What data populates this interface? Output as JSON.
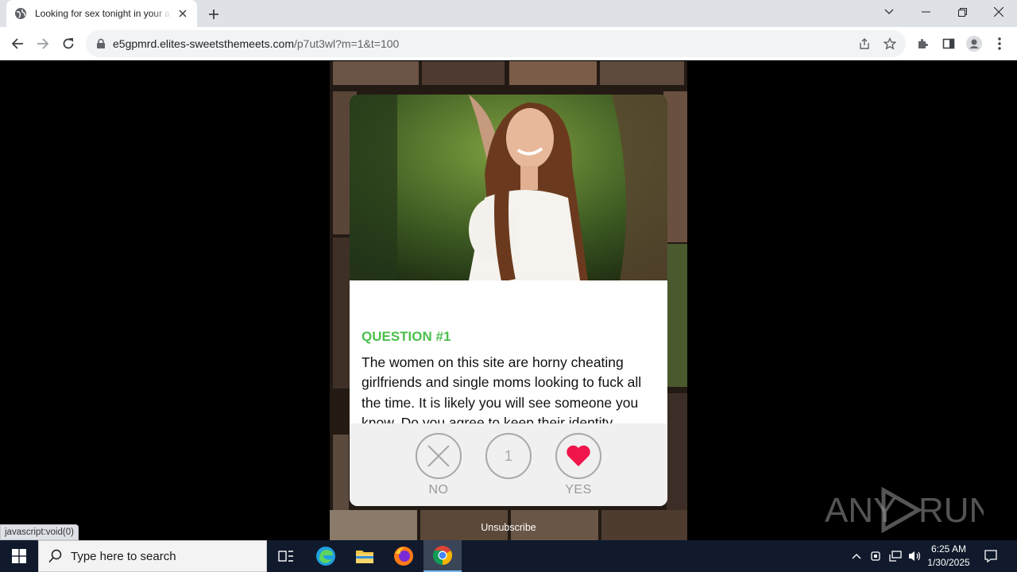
{
  "browser": {
    "tab_title": "Looking for sex tonight in your area",
    "url_host": "e5gpmrd.elites-sweetsthemeets.com",
    "url_path": "/p7ut3wl?m=1&t=100",
    "status_text": "javascript:void(0)"
  },
  "quiz": {
    "question_title": "QUESTION #1",
    "question_text": "The women on this site are horny cheating girlfriends and single moms looking to fuck all the time. It is likely you will see someone you know. Do you agree to keep their identity secret?",
    "no_label": "NO",
    "counter": "1",
    "yes_label": "YES",
    "accent_color": "#4cbf4c",
    "heart_color": "#f0154b"
  },
  "footer": {
    "unsubscribe": "Unsubscribe"
  },
  "watermark": {
    "text_left": "ANY",
    "text_right": "RUN"
  },
  "taskbar": {
    "search_placeholder": "Type here to search",
    "time": "6:25 AM",
    "date": "1/30/2025"
  }
}
